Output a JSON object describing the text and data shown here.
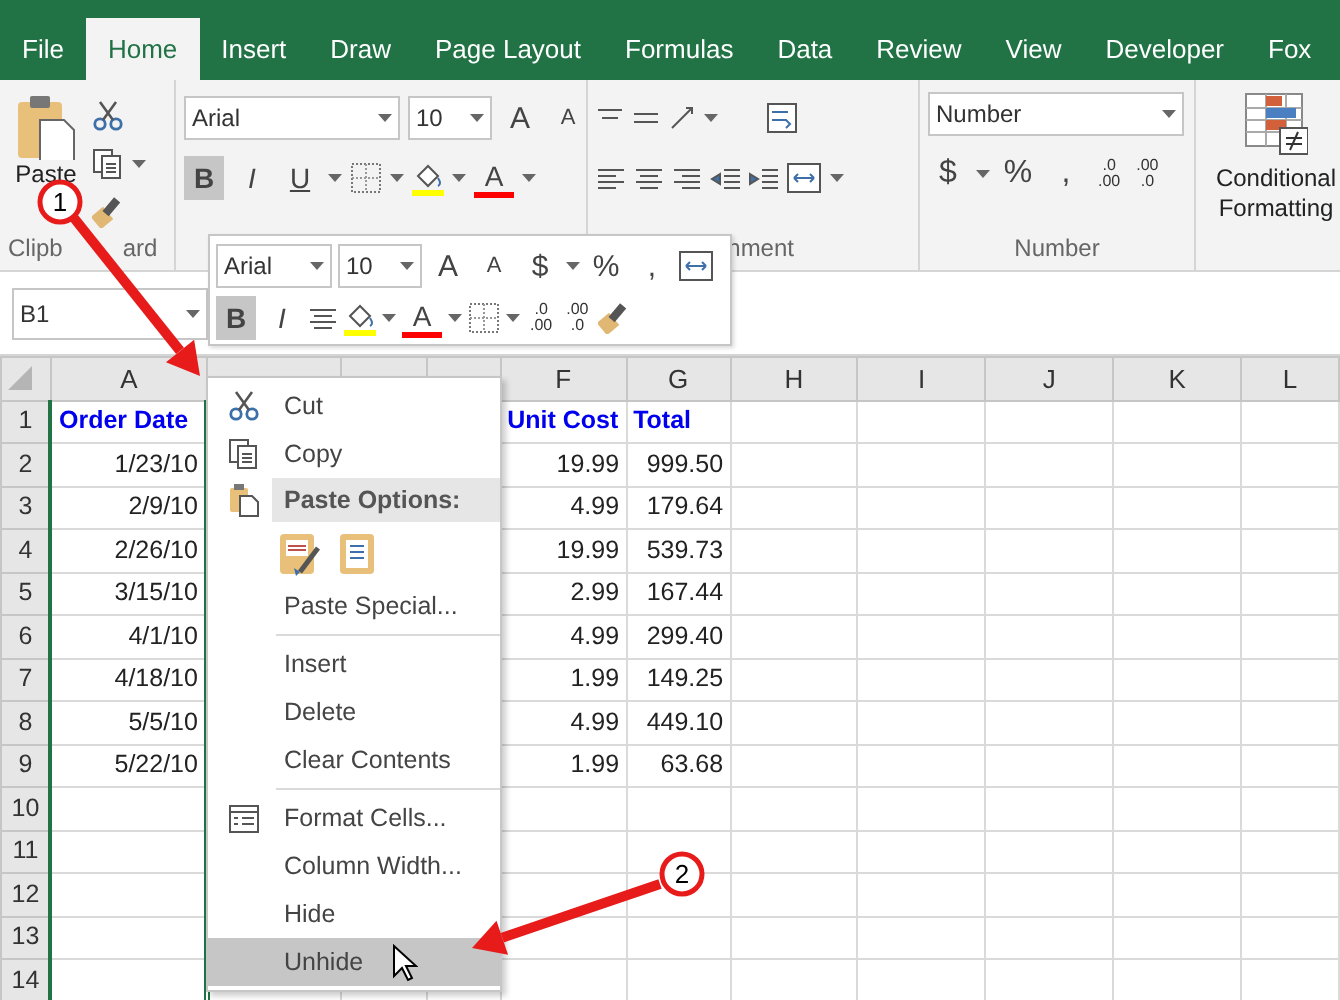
{
  "tabs": [
    {
      "label": "File",
      "selected": false
    },
    {
      "label": "Home",
      "selected": true
    },
    {
      "label": "Insert",
      "selected": false
    },
    {
      "label": "Draw",
      "selected": false
    },
    {
      "label": "Page Layout",
      "selected": false
    },
    {
      "label": "Formulas",
      "selected": false
    },
    {
      "label": "Data",
      "selected": false
    },
    {
      "label": "Review",
      "selected": false
    },
    {
      "label": "View",
      "selected": false
    },
    {
      "label": "Developer",
      "selected": false
    },
    {
      "label": "Fox",
      "selected": false
    }
  ],
  "ribbon": {
    "clipboard": {
      "paste": "Paste",
      "label_parts": [
        "Clipb",
        "ard"
      ]
    },
    "font": {
      "name": "Arial",
      "size": "10",
      "grow": "A",
      "shrink": "A",
      "styles": [
        {
          "label": "B",
          "pressed": true
        },
        {
          "label": "I",
          "pressed": false
        },
        {
          "label": "U",
          "pressed": false
        }
      ],
      "font_color": "A"
    },
    "alignment": {
      "label": "nment"
    },
    "number": {
      "format": "Number",
      "symbols": [
        "$",
        "%",
        ","
      ],
      "increase_decimal": [
        ".0",
        ".00"
      ],
      "decrease_decimal": [
        ".00",
        ".0"
      ],
      "label": "Number"
    },
    "styles": {
      "conditional_formatting": "Conditional Formatting"
    }
  },
  "name_box": "B1",
  "mini_toolbar": {
    "name": "Arial",
    "size": "10",
    "grow": "A",
    "shrink": "A",
    "symbols": [
      "$",
      "%",
      ","
    ],
    "styles": [
      {
        "label": "B",
        "pressed": true
      },
      {
        "label": "I",
        "pressed": false
      }
    ],
    "font_color": "A",
    "increase_decimal": [
      ".0",
      ".00"
    ],
    "decrease_decimal": [
      ".00",
      ".0"
    ]
  },
  "columns": [
    {
      "kind": "label",
      "label": "A"
    },
    {
      "kind": "covered"
    },
    {
      "kind": "covered"
    },
    {
      "kind": "covered"
    },
    {
      "kind": "label",
      "label": "F"
    },
    {
      "kind": "label",
      "label": "G"
    },
    {
      "kind": "label",
      "label": "H"
    },
    {
      "kind": "label",
      "label": "I"
    },
    {
      "kind": "label",
      "label": "J"
    },
    {
      "kind": "label",
      "label": "K"
    },
    {
      "kind": "label",
      "label": "L"
    }
  ],
  "rows": [
    {
      "number": "1",
      "kind": "header",
      "order_date": "Order Date",
      "unit_cost": "Unit Cost",
      "total": "Total"
    },
    {
      "number": "2",
      "kind": "data",
      "order_date": "1/23/10",
      "unit_cost": "19.99",
      "total": "999.50"
    },
    {
      "number": "3",
      "kind": "data",
      "order_date": "2/9/10",
      "unit_cost": "4.99",
      "total": "179.64"
    },
    {
      "number": "4",
      "kind": "data",
      "order_date": "2/26/10",
      "unit_cost": "19.99",
      "total": "539.73"
    },
    {
      "number": "5",
      "kind": "data",
      "order_date": "3/15/10",
      "unit_cost": "2.99",
      "total": "167.44"
    },
    {
      "number": "6",
      "kind": "data",
      "order_date": "4/1/10",
      "unit_cost": "4.99",
      "total": "299.40"
    },
    {
      "number": "7",
      "kind": "data",
      "order_date": "4/18/10",
      "unit_cost": "1.99",
      "total": "149.25"
    },
    {
      "number": "8",
      "kind": "data",
      "order_date": "5/5/10",
      "unit_cost": "4.99",
      "total": "449.10"
    },
    {
      "number": "9",
      "kind": "data",
      "order_date": "5/22/10",
      "unit_cost": "1.99",
      "total": "63.68"
    },
    {
      "number": "10",
      "kind": "empty"
    },
    {
      "number": "11",
      "kind": "empty"
    },
    {
      "number": "12",
      "kind": "empty"
    },
    {
      "number": "13",
      "kind": "empty"
    },
    {
      "number": "14",
      "kind": "empty"
    }
  ],
  "context_menu": {
    "items": [
      {
        "kind": "cut",
        "label": "Cut",
        "separator_before": false,
        "highlighted": false
      },
      {
        "kind": "copy",
        "label": "Copy",
        "separator_before": false,
        "highlighted": false
      },
      {
        "kind": "paste-options",
        "label": "Paste Options:",
        "separator_before": false,
        "highlighted": false
      },
      {
        "kind": "paste-buttons",
        "separator_before": false,
        "highlighted": false
      },
      {
        "kind": "plain",
        "label": "Paste Special...",
        "separator_before": false,
        "highlighted": false
      },
      {
        "kind": "plain",
        "label": "Insert",
        "separator_before": true,
        "highlighted": false
      },
      {
        "kind": "plain",
        "label": "Delete",
        "separator_before": false,
        "highlighted": false
      },
      {
        "kind": "plain",
        "label": "Clear Contents",
        "separator_before": false,
        "highlighted": false
      },
      {
        "kind": "format-cells",
        "label": "Format Cells...",
        "separator_before": true,
        "highlighted": false
      },
      {
        "kind": "plain",
        "label": "Column Width...",
        "separator_before": false,
        "highlighted": false
      },
      {
        "kind": "plain",
        "label": "Hide",
        "separator_before": false,
        "highlighted": false
      },
      {
        "kind": "plain",
        "label": "Unhide",
        "separator_before": false,
        "highlighted": true
      }
    ]
  },
  "callouts": [
    {
      "number": "1"
    },
    {
      "number": "2"
    }
  ]
}
